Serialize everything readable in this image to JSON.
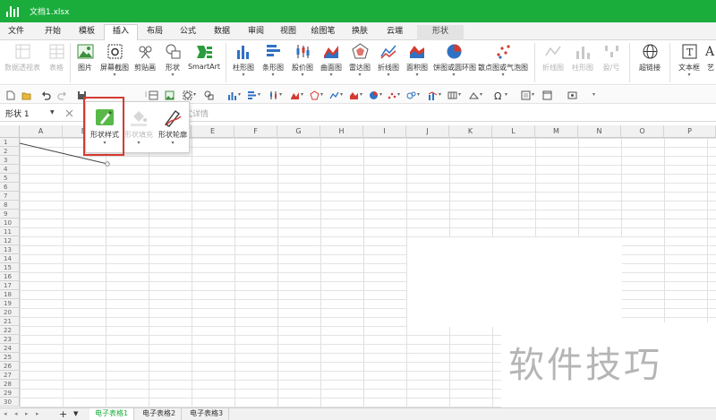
{
  "app": {
    "file_title": "文档1.xlsx",
    "accent": "#1aad3c"
  },
  "menu": {
    "tabs": [
      "文件",
      "开始",
      "模板",
      "插入",
      "布局",
      "公式",
      "数据",
      "审阅",
      "视图",
      "绘图笔",
      "换肤",
      "云端"
    ],
    "active": "插入",
    "context_tab": "形状"
  },
  "ribbon": {
    "buttons": [
      "数据透视表",
      "表格",
      "图片",
      "屏幕截图",
      "剪贴画",
      "形状",
      "SmartArt",
      "柱形图",
      "条形图",
      "股价图",
      "曲面图",
      "雷达图",
      "折线图",
      "面积图",
      "饼图或圆环图",
      "散点图或气泡图",
      "折线图",
      "柱形图",
      "盈/亏",
      "超链接",
      "文本框",
      "艺"
    ]
  },
  "formula_bar": {
    "name_box": "形状 1",
    "trailing_text": "式详情"
  },
  "shape_popup": {
    "style_label": "形状样式",
    "fill_label": "形状填充",
    "outline_label": "形状轮廓"
  },
  "columns": [
    "A",
    "B",
    "C",
    "D",
    "E",
    "F",
    "G",
    "H",
    "I",
    "J",
    "K",
    "L",
    "M",
    "N",
    "O",
    "P"
  ],
  "rows": [
    "1",
    "2",
    "3",
    "4",
    "5",
    "6",
    "7",
    "8",
    "9",
    "10",
    "11",
    "12",
    "13",
    "14",
    "15",
    "16",
    "17",
    "18",
    "19",
    "20",
    "21",
    "22",
    "23",
    "24",
    "25",
    "26",
    "27",
    "28",
    "29",
    "30"
  ],
  "sheets": {
    "tabs": [
      "电子表格1",
      "电子表格2",
      "电子表格3"
    ],
    "active": "电子表格1",
    "add": "+"
  },
  "watermark": "软件技巧"
}
